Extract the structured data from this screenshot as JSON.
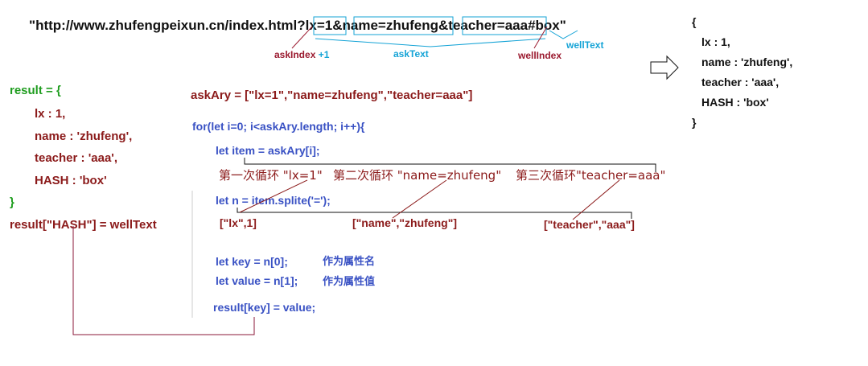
{
  "url": {
    "quote_open": "\"",
    "prefix": "http://www.zhufengpeixun.cn/index.html",
    "qmark": "?",
    "p1": "lx=1",
    "amp1": "&",
    "p2": "name=zhufeng",
    "amp2": "&",
    "p3": "teacher=aaa",
    "hash": "#box",
    "quote_close": "\""
  },
  "labels": {
    "ask_index": "askIndex",
    "ask_index_plus": "+1",
    "ask_text": "askText",
    "well_index": "wellIndex",
    "well_text": "wellText"
  },
  "result_obj": {
    "head": "result =  {",
    "lx": "lx : 1,",
    "name": "name : 'zhufeng',",
    "teacher": "teacher : 'aaa',",
    "hash": "HASH : 'box'",
    "close": "}",
    "hash_assign": "result[\"HASH\"] = wellText"
  },
  "right_obj": {
    "open": "{",
    "lx": "lx : 1,",
    "name": "name : 'zhufeng',",
    "teacher": "teacher : 'aaa',",
    "hash": "HASH : 'box'",
    "close": "}"
  },
  "code": {
    "ask_ary": "askAry = [\"lx=1\",\"name=zhufeng\",\"teacher=aaa\"]",
    "for_loop": "for(let i=0; i<askAry.length; i++){",
    "item": "let item = askAry[i];",
    "loop1": "第一次循环 \"lx=1\"",
    "loop2": "第二次循环 \"name=zhufeng\"",
    "loop3": "第三次循环\"teacher=aaa\"",
    "split": "let n = item.splite('=');",
    "res1": "[\"lx\",1]",
    "res2": "[\"name\",\"zhufeng\"]",
    "res3": "[\"teacher\",\"aaa\"]",
    "key": "let key = n[0];",
    "key_note": "作为属性名",
    "value": "let value = n[1];",
    "value_note": "作为属性值",
    "assign": "result[key] = value;"
  }
}
